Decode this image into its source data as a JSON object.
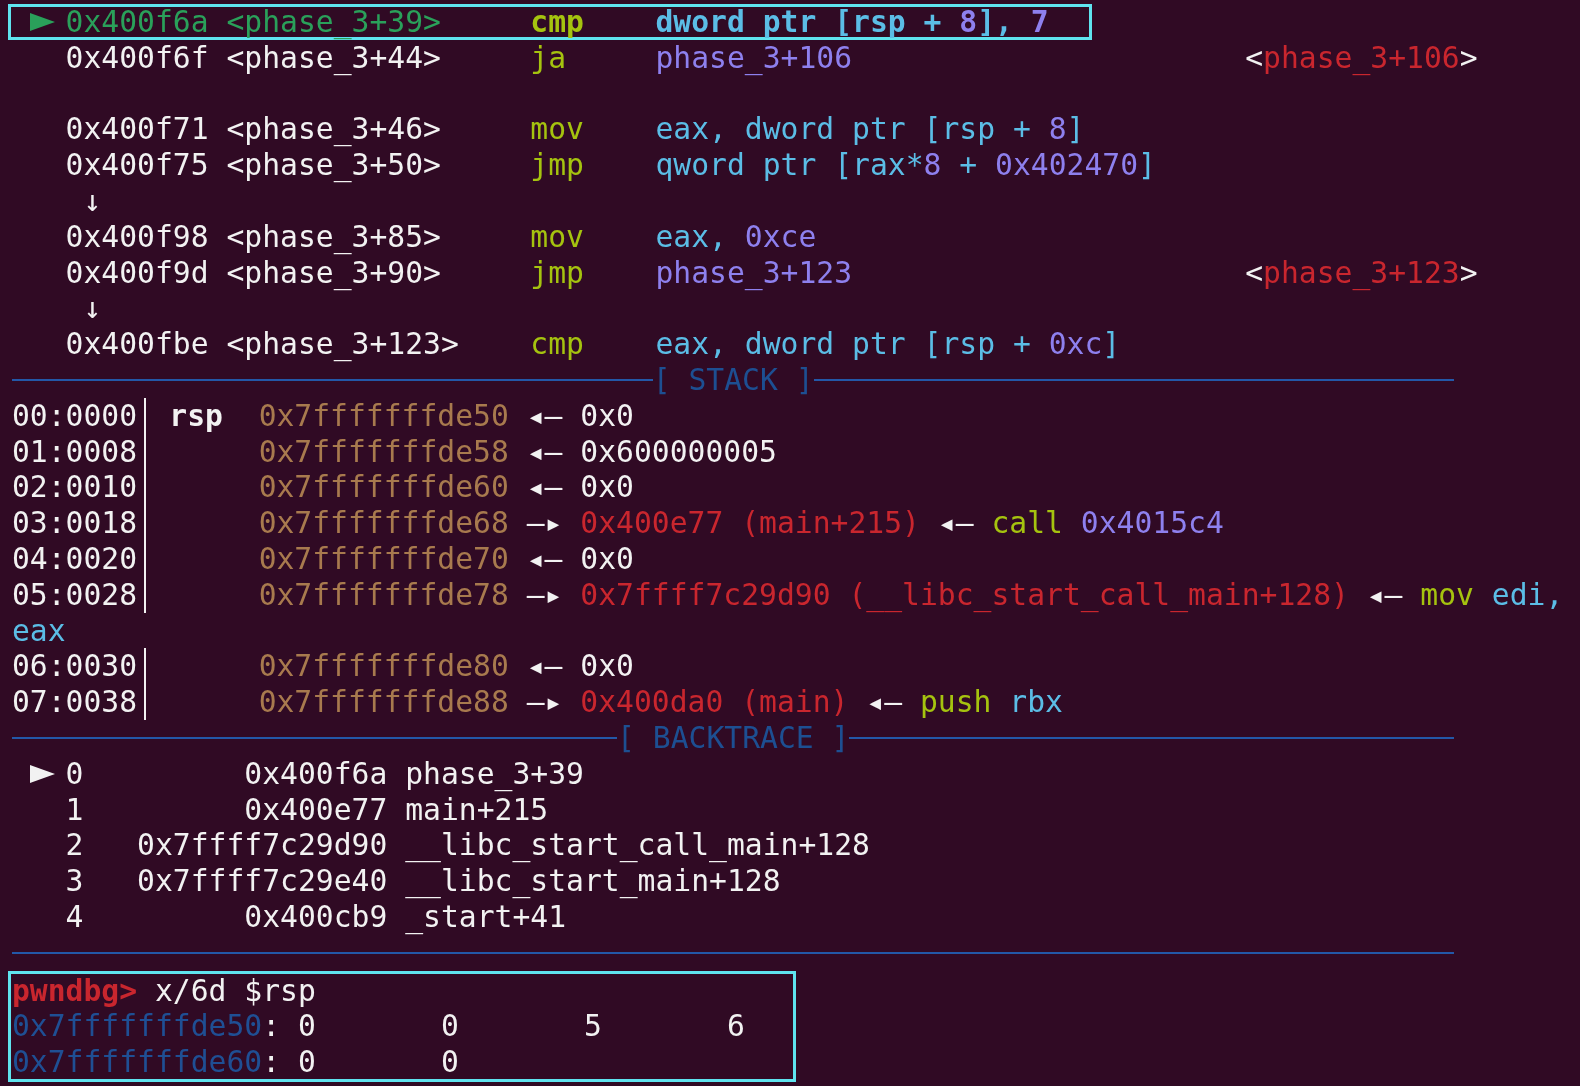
{
  "disassembly": [
    {
      "kind": "insn",
      "current": true,
      "highlighted": true,
      "address": "0x400f6a",
      "symbol": "<phase_3+39>",
      "mnemonic": "cmp",
      "operands": [
        {
          "text": "dword ptr [rsp + ",
          "kind": "reg"
        },
        {
          "text": "8",
          "kind": "num"
        },
        {
          "text": "], ",
          "kind": "reg"
        },
        {
          "text": "7",
          "kind": "num"
        }
      ]
    },
    {
      "kind": "insn",
      "current": false,
      "highlighted": false,
      "address": "0x400f6f",
      "symbol": "<phase_3+44>",
      "mnemonic": "ja",
      "operands": [
        {
          "text": "phase_3+106",
          "kind": "num"
        }
      ],
      "target": [
        {
          "text": "<",
          "kind": "plain"
        },
        {
          "text": "phase_3+106",
          "kind": "sym"
        },
        {
          "text": ">",
          "kind": "plain"
        }
      ]
    },
    {
      "kind": "blank"
    },
    {
      "kind": "insn",
      "current": false,
      "highlighted": false,
      "address": "0x400f71",
      "symbol": "<phase_3+46>",
      "mnemonic": "mov",
      "operands": [
        {
          "text": "eax, dword ptr [rsp + ",
          "kind": "reg"
        },
        {
          "text": "8",
          "kind": "num"
        },
        {
          "text": "]",
          "kind": "reg"
        }
      ]
    },
    {
      "kind": "insn",
      "current": false,
      "highlighted": false,
      "address": "0x400f75",
      "symbol": "<phase_3+50>",
      "mnemonic": "jmp",
      "operands": [
        {
          "text": "qword ptr [rax*",
          "kind": "reg"
        },
        {
          "text": "8",
          "kind": "num"
        },
        {
          "text": " + ",
          "kind": "reg"
        },
        {
          "text": "0x402470",
          "kind": "num"
        },
        {
          "text": "]",
          "kind": "reg"
        }
      ]
    },
    {
      "kind": "jump",
      "glyph": "↓"
    },
    {
      "kind": "insn",
      "current": false,
      "highlighted": false,
      "address": "0x400f98",
      "symbol": "<phase_3+85>",
      "mnemonic": "mov",
      "operands": [
        {
          "text": "eax, ",
          "kind": "reg"
        },
        {
          "text": "0xce",
          "kind": "num"
        }
      ]
    },
    {
      "kind": "insn",
      "current": false,
      "highlighted": false,
      "address": "0x400f9d",
      "symbol": "<phase_3+90>",
      "mnemonic": "jmp",
      "operands": [
        {
          "text": "phase_3+123",
          "kind": "num"
        }
      ],
      "target": [
        {
          "text": "<",
          "kind": "plain"
        },
        {
          "text": "phase_3+123",
          "kind": "sym"
        },
        {
          "text": ">",
          "kind": "plain"
        }
      ]
    },
    {
      "kind": "jump",
      "glyph": "↓"
    },
    {
      "kind": "insn",
      "current": false,
      "highlighted": false,
      "address": "0x400fbe",
      "symbol": "<phase_3+123>",
      "mnemonic": "cmp",
      "operands": [
        {
          "text": "eax, dword ptr [rsp + ",
          "kind": "reg"
        },
        {
          "text": "0xc",
          "kind": "num"
        },
        {
          "text": "]",
          "kind": "reg"
        }
      ]
    }
  ],
  "stack": {
    "title": "[ STACK ]",
    "rows": [
      {
        "kind": "entry",
        "offset": "00:0000",
        "register": "rsp",
        "address": "0x7fffffffde50",
        "chain": [
          {
            "arrow": "◂—",
            "tokens": [
              {
                "text": "0x0",
                "kind": "plain"
              }
            ]
          }
        ]
      },
      {
        "kind": "entry",
        "offset": "01:0008",
        "address": "0x7fffffffde58",
        "chain": [
          {
            "arrow": "◂—",
            "tokens": [
              {
                "text": "0x600000005",
                "kind": "plain"
              }
            ]
          }
        ]
      },
      {
        "kind": "entry",
        "offset": "02:0010",
        "address": "0x7fffffffde60",
        "chain": [
          {
            "arrow": "◂—",
            "tokens": [
              {
                "text": "0x0",
                "kind": "plain"
              }
            ]
          }
        ]
      },
      {
        "kind": "entry",
        "offset": "03:0018",
        "address": "0x7fffffffde68",
        "chain": [
          {
            "arrow": "—▸",
            "tokens": [
              {
                "text": "0x400e77 (main+215)",
                "kind": "sym"
              }
            ]
          },
          {
            "arrow": "◂—",
            "tokens": [
              {
                "text": "call ",
                "kind": "mnem"
              },
              {
                "text": "0x4015c4",
                "kind": "num"
              }
            ]
          }
        ]
      },
      {
        "kind": "entry",
        "offset": "04:0020",
        "address": "0x7fffffffde70",
        "chain": [
          {
            "arrow": "◂—",
            "tokens": [
              {
                "text": "0x0",
                "kind": "plain"
              }
            ]
          }
        ]
      },
      {
        "kind": "entry",
        "offset": "05:0028",
        "address": "0x7fffffffde78",
        "chain": [
          {
            "arrow": "—▸",
            "tokens": [
              {
                "text": "0x7ffff7c29d90 (__libc_start_call_main+128)",
                "kind": "sym"
              }
            ]
          },
          {
            "arrow": "◂—",
            "tokens": [
              {
                "text": "mov ",
                "kind": "mnem"
              },
              {
                "text": "edi,",
                "kind": "reg"
              }
            ]
          }
        ]
      },
      {
        "kind": "wrap",
        "tokens": [
          {
            "text": "eax",
            "kind": "reg"
          }
        ]
      },
      {
        "kind": "entry",
        "offset": "06:0030",
        "address": "0x7fffffffde80",
        "chain": [
          {
            "arrow": "◂—",
            "tokens": [
              {
                "text": "0x0",
                "kind": "plain"
              }
            ]
          }
        ]
      },
      {
        "kind": "entry",
        "offset": "07:0038",
        "address": "0x7fffffffde88",
        "chain": [
          {
            "arrow": "—▸",
            "tokens": [
              {
                "text": "0x400da0 (main)",
                "kind": "sym"
              }
            ]
          },
          {
            "arrow": "◂—",
            "tokens": [
              {
                "text": "push ",
                "kind": "mnem"
              },
              {
                "text": "rbx",
                "kind": "reg"
              }
            ]
          }
        ]
      }
    ]
  },
  "backtrace": {
    "title": "[ BACKTRACE ]",
    "frames": [
      {
        "current": true,
        "index": "0",
        "address": "0x400f6a",
        "symbol": "phase_3+39"
      },
      {
        "current": false,
        "index": "1",
        "address": "0x400e77",
        "symbol": "main+215"
      },
      {
        "current": false,
        "index": "2",
        "address": "0x7ffff7c29d90",
        "symbol": "__libc_start_call_main+128"
      },
      {
        "current": false,
        "index": "3",
        "address": "0x7ffff7c29e40",
        "symbol": "__libc_start_main+128"
      },
      {
        "current": false,
        "index": "4",
        "address": "0x400cb9",
        "symbol": "_start+41"
      }
    ]
  },
  "console": {
    "highlighted": true,
    "prompt": "pwndbg>",
    "command": "x/6d $rsp",
    "lines": [
      {
        "address": "0x7fffffffde50",
        "separator": ":",
        "values": [
          "0",
          "0",
          "5",
          "6"
        ]
      },
      {
        "address": "0x7fffffffde60",
        "separator": ":",
        "values": [
          "0",
          "0"
        ]
      }
    ]
  }
}
